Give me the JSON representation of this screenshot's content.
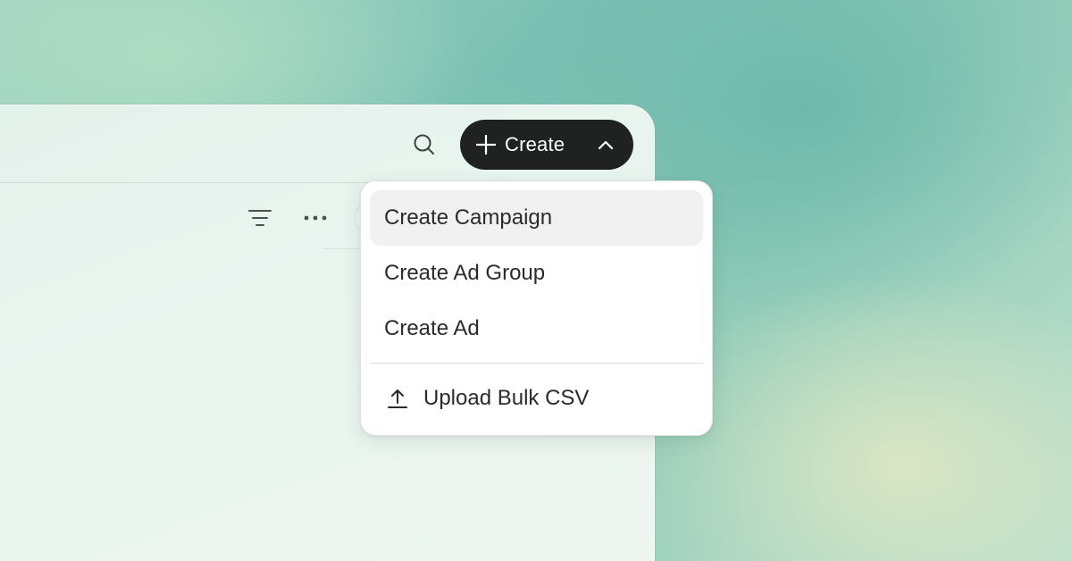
{
  "header": {
    "create_label": "Create"
  },
  "create_menu": {
    "items": [
      {
        "label": "Create Campaign",
        "active": true
      },
      {
        "label": "Create Ad Group",
        "active": false
      },
      {
        "label": "Create Ad",
        "active": false
      }
    ],
    "upload_label": "Upload Bulk CSV"
  },
  "icons": {
    "search": "search-icon",
    "plus": "plus-icon",
    "chevron": "chevron-up-icon",
    "filter": "filter-icon",
    "more": "more-horizontal-icon",
    "upload": "upload-icon"
  },
  "colors": {
    "create_button_bg": "#1f2221",
    "menu_active_bg": "#f1f1f1"
  }
}
